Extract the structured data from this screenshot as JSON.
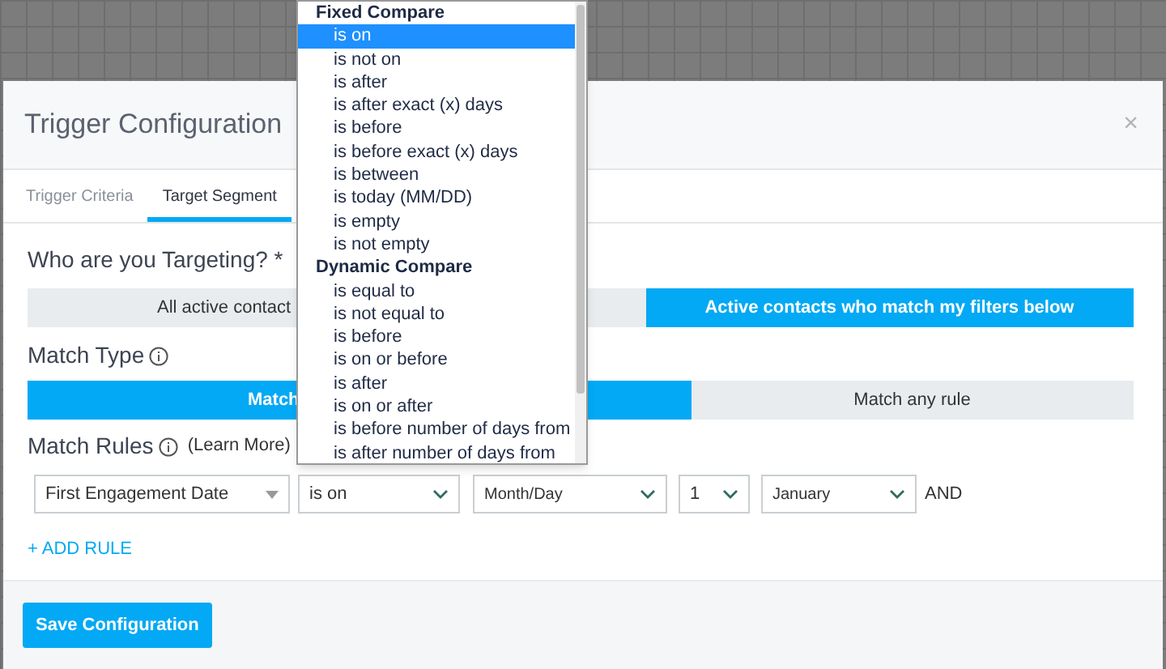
{
  "modal": {
    "title": "Trigger Configuration",
    "close": "×"
  },
  "tabs": [
    {
      "label": "Trigger Criteria",
      "selected": false
    },
    {
      "label": "Target Segment",
      "selected": true
    }
  ],
  "targeting": {
    "label": "Who are you Targeting? *",
    "options": [
      {
        "label": "All active contact",
        "selected": false
      },
      {
        "label": "Active contacts who match my filters below",
        "selected": true
      }
    ]
  },
  "match_type": {
    "label": "Match Type",
    "options": [
      {
        "label": "Match",
        "selected": true
      },
      {
        "label": "Match any rule",
        "selected": false
      }
    ]
  },
  "match_rules": {
    "label": "Match Rules",
    "link": "(Learn More)"
  },
  "rule": {
    "field": "First Engagement Date",
    "operator": "is on",
    "date_type": "Month/Day",
    "day": "1",
    "month": "January",
    "conjunction": "AND"
  },
  "add_rule": "+ ADD RULE",
  "save_button": "Save Configuration",
  "dropdown": [
    {
      "group": "Fixed Compare",
      "options": [
        {
          "label": "is on",
          "selected": true
        },
        {
          "label": "is not on",
          "selected": false
        },
        {
          "label": "is after",
          "selected": false
        },
        {
          "label": "is after exact (x) days",
          "selected": false
        },
        {
          "label": "is before",
          "selected": false
        },
        {
          "label": "is before exact (x) days",
          "selected": false
        },
        {
          "label": "is between",
          "selected": false
        },
        {
          "label": "is today (MM/DD)",
          "selected": false
        },
        {
          "label": "is empty",
          "selected": false
        },
        {
          "label": "is not empty",
          "selected": false
        }
      ]
    },
    {
      "group": "Dynamic Compare",
      "options": [
        {
          "label": "is equal to",
          "selected": false
        },
        {
          "label": "is not equal to",
          "selected": false
        },
        {
          "label": "is before",
          "selected": false
        },
        {
          "label": "is on or before",
          "selected": false
        },
        {
          "label": "is after",
          "selected": false
        },
        {
          "label": "is on or after",
          "selected": false
        },
        {
          "label": "is before number of days from",
          "selected": false
        },
        {
          "label": "is after number of days from",
          "selected": false
        }
      ]
    }
  ]
}
